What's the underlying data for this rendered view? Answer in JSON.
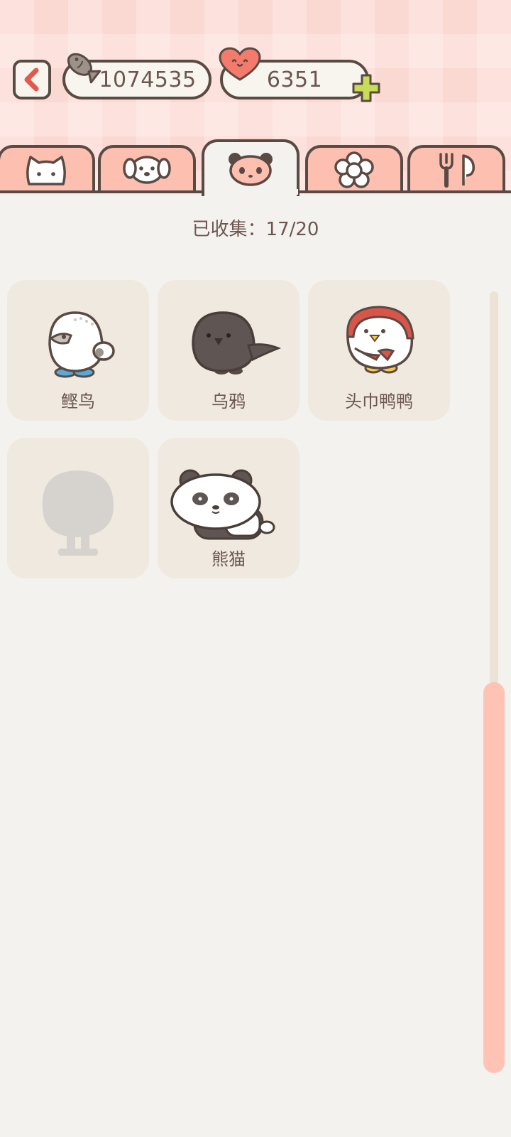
{
  "header": {
    "fish_currency": "1074535",
    "heart_currency": "6351"
  },
  "tabs": [
    {
      "icon": "cat-face-icon",
      "active": false
    },
    {
      "icon": "dog-face-icon",
      "active": false
    },
    {
      "icon": "panda-face-icon",
      "active": true
    },
    {
      "icon": "flower-icon",
      "active": false
    },
    {
      "icon": "fork-spoon-icon",
      "active": false
    }
  ],
  "collection": {
    "progress_label": "已收集：17/20",
    "animals": [
      {
        "name": "鲣鸟",
        "icon": "booby-bird-icon",
        "locked": false
      },
      {
        "name": "乌鸦",
        "icon": "crow-icon",
        "locked": false
      },
      {
        "name": "头巾鸭鸭",
        "icon": "headscarf-duck-icon",
        "locked": false
      },
      {
        "name": "",
        "icon": "locked-silhouette-icon",
        "locked": true
      },
      {
        "name": "熊猫",
        "icon": "panda-icon",
        "locked": false
      }
    ]
  },
  "colors": {
    "header_bg": "#fbd9d3",
    "tab_bg": "#fdbfb0",
    "outline": "#5a4a44",
    "card_bg": "#efe9df",
    "scroll_thumb": "#fec3b4",
    "back_arrow": "#e05a4e",
    "plus": "#c6dd55"
  }
}
